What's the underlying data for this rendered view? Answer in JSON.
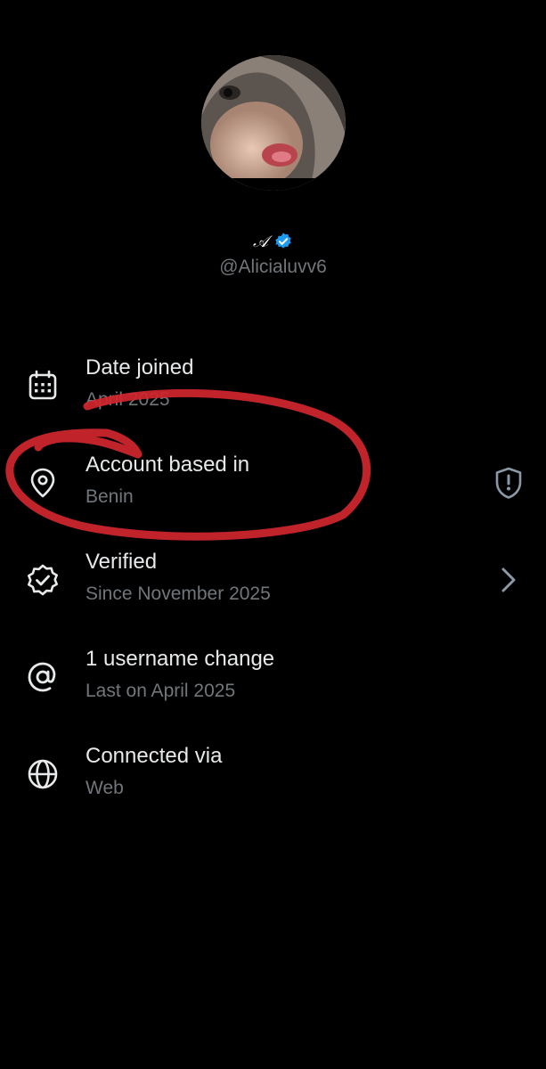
{
  "profile": {
    "display_name": "𝒜",
    "handle": "@Alicialuvv6",
    "verified_badge": "verified-check-icon",
    "badge_color": "#1d9bf0"
  },
  "rows": [
    {
      "title": "Date joined",
      "sub": "April 2025",
      "icon": "calendar-icon"
    },
    {
      "title": "Account based in",
      "sub": "Benin",
      "icon": "location-pin-icon",
      "right_icon": "shield-alert-icon"
    },
    {
      "title": "Verified",
      "sub": "Since November 2025",
      "icon": "verified-badge-icon",
      "right_icon": "chevron-right-icon"
    },
    {
      "title": "1 username change",
      "sub": "Last on April 2025",
      "icon": "at-sign-icon"
    },
    {
      "title": "Connected via",
      "sub": "Web",
      "icon": "globe-icon"
    }
  ],
  "annotation": {
    "color": "#d0262c",
    "shape": "hand-drawn circle around Account based in"
  }
}
